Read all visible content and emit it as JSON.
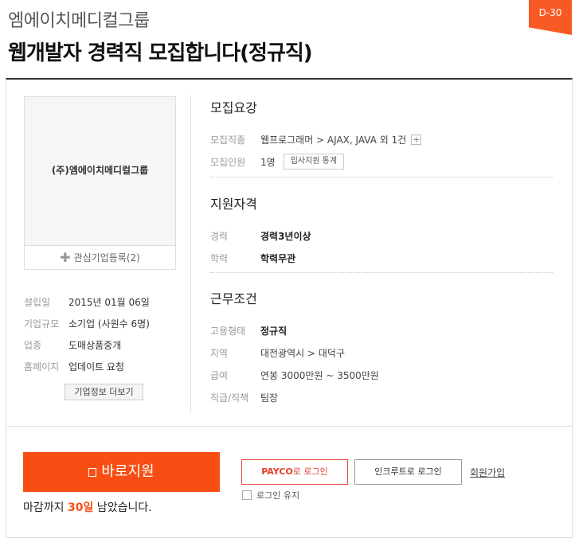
{
  "header": {
    "company": "엠에이치메디컬그룹",
    "title": "웹개발자 경력직 모집합니다(정규직)",
    "dday": "D-30"
  },
  "company_card": {
    "logo_text": "(주)엠에이치메디컬그룹",
    "favorite_label": "관심기업등록(2)",
    "info": [
      {
        "label": "설립일",
        "value": "2015년 01월 06일"
      },
      {
        "label": "기업규모",
        "value": "소기업 (사원수 6명)"
      },
      {
        "label": "업종",
        "value": "도매상품중개"
      },
      {
        "label": "홈페이지",
        "value": "업데이트 요청"
      }
    ],
    "more_button": "기업정보 더보기"
  },
  "recruit": {
    "title": "모집요강",
    "field_label": "모집직종",
    "field_value": "웹프로그래머 > AJAX, JAVA 외 1건",
    "field_more": "+",
    "count_label": "모집인원",
    "count_value": "1명",
    "stats_button": "입사지원 통계"
  },
  "qualification": {
    "title": "지원자격",
    "rows": [
      {
        "label": "경력",
        "value": "경력3년이상"
      },
      {
        "label": "학력",
        "value": "학력무관"
      }
    ]
  },
  "conditions": {
    "title": "근무조건",
    "rows": [
      {
        "label": "고용형태",
        "value": "정규직"
      },
      {
        "label": "지역",
        "value": "대전광역시 > 대덕구"
      },
      {
        "label": "급여",
        "value": "연봉 3000만원 ~ 3500만원"
      },
      {
        "label": "직급/직책",
        "value": "팀장"
      }
    ]
  },
  "apply": {
    "button": "바로지원",
    "deadline_prefix": "마감까지 ",
    "deadline_days": "30일",
    "deadline_suffix": " 남았습니다."
  },
  "login": {
    "payco_brand": "PAYCO",
    "payco_suffix": "로 로그인",
    "incruit": "인크루트로 로그인",
    "join": "회원가입",
    "keep_login": "로그인 유지"
  },
  "colors": {
    "accent": "#f84e14",
    "payco": "#e43d2a"
  }
}
